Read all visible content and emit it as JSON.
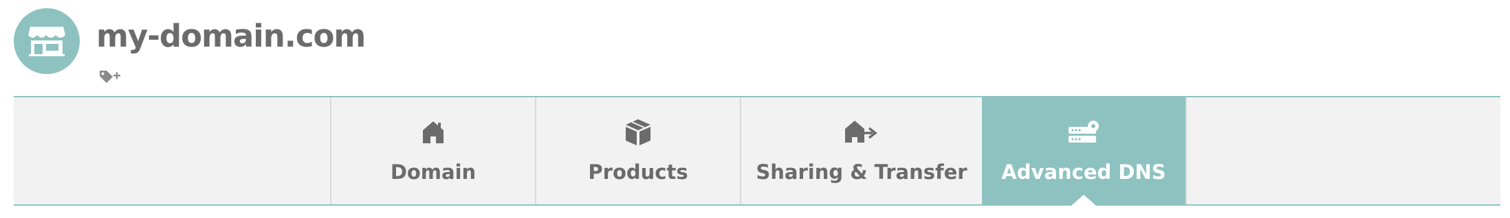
{
  "header": {
    "domain_name": "my-domain.com",
    "avatar_icon": "storefront-icon",
    "tag_icon": "add-tag-icon",
    "text_color": "#6b6b6b"
  },
  "colors": {
    "accent": "#8dc2c1",
    "tabbar_bg": "#f2f2f2",
    "tab_text": "#6b6b6b",
    "active_text": "#ffffff"
  },
  "tabs": [
    {
      "label": "Domain",
      "icon": "house-icon",
      "active": false
    },
    {
      "label": "Products",
      "icon": "box-icon",
      "active": false
    },
    {
      "label": "Sharing & Transfer",
      "icon": "house-arrow-icon",
      "active": false
    },
    {
      "label": "Advanced DNS",
      "icon": "dns-server-gear-icon",
      "active": true
    }
  ]
}
